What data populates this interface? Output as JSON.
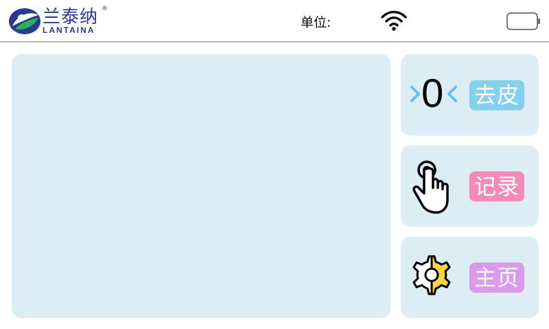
{
  "header": {
    "logo_cn": "兰泰纳",
    "logo_en": "LANTAINA",
    "logo_reg": "®",
    "unit_label": "单位:"
  },
  "icons": {
    "wifi": "wifi-icon",
    "battery": "battery-icon",
    "tare": "zero-tare-icon",
    "record": "tap-hand-icon",
    "home": "gear-icon"
  },
  "buttons": {
    "tare": {
      "label": "去皮",
      "zero": "0",
      "color": "#85d0ef"
    },
    "record": {
      "label": "记录",
      "color": "#f28bb9"
    },
    "home": {
      "label": "主页",
      "color": "#dc9bea"
    }
  },
  "colors": {
    "panel": "#dcedf6",
    "brand": "#2a3a8c",
    "chevron": "#62c3ea",
    "gear_accent": "#f6d348"
  }
}
